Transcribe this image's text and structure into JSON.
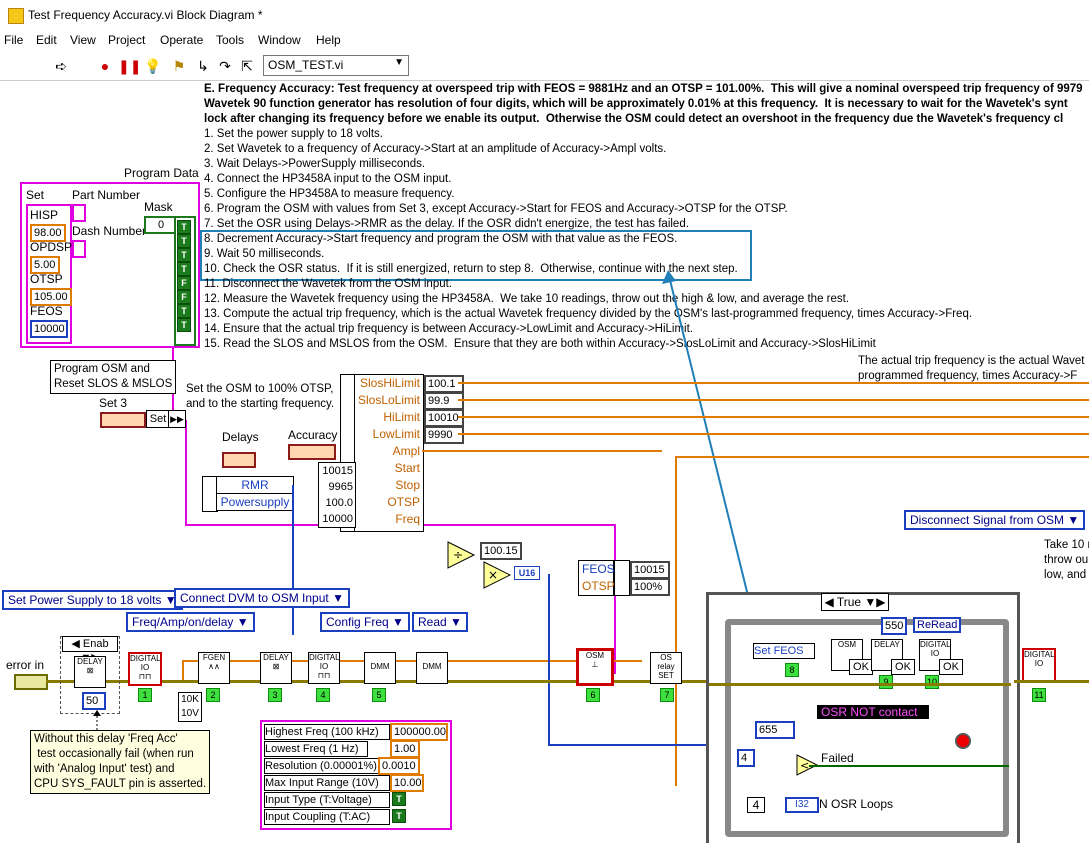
{
  "window": {
    "title": "Test Frequency Accuracy.vi Block Diagram *"
  },
  "menu": [
    "File",
    "Edit",
    "View",
    "Project",
    "Operate",
    "Tools",
    "Window",
    "Help"
  ],
  "toolbar": {
    "context_dropdown": "OSM_TEST.vi"
  },
  "comment": {
    "heading": "E. Frequency Accuracy: Test frequency at overspeed trip with FEOS = 9881Hz and an OTSP = 101.00%.  This will give a nominal overspeed trip frequency of 9979",
    "line2": "Wavetek 90 function generator has resolution of four digits, which will be approximately 0.01% at this frequency.  It is necessary to wait for the Wavetek's synt",
    "line3": "lock after changing its frequency before we enable its output.  Otherwise the OSM could detect an overshoot in the frequency due the Wavetek's frequency cl",
    "steps": [
      "1. Set the power supply to 18 volts.",
      "2. Set Wavetek to a frequency of Accuracy->Start at an amplitude of Accuracy->Ampl volts.",
      "3. Wait Delays->PowerSupply milliseconds.",
      "4. Connect the HP3458A input to the OSM input.",
      "5. Configure the HP3458A to measure frequency.",
      "6. Program the OSM with values from Set 3, except Accuracy->Start for FEOS and Accuracy->OTSP for the OTSP.",
      "7. Set the OSR using Delays->RMR as the delay. If the OSR didn't energize, the test has failed.",
      "8. Decrement Accuracy->Start frequency and program the OSM with that value as the FEOS.",
      "9. Wait 50 milliseconds.",
      "10. Check the OSR status.  If it is still energized, return to step 8.  Otherwise, continue with the next step.",
      "11. Disconnect the Wavetek from the OSM input.",
      "12. Measure the Wavetek frequency using the HP3458A.  We take 10 readings, throw out the high & low, and average the rest.",
      "13. Compute the actual trip frequency, which is the actual Wavetek frequency divided by the OSM's last-programmed frequency, times Accuracy->Freq.",
      "14. Ensure that the actual trip frequency is between Accuracy->LowLimit and Accuracy->HiLimit.",
      "15. Read the SLOS and MSLOS from the OSM.  Ensure that they are both within Accuracy->SlosLoLimit and Accuracy->SlosHiLimit"
    ],
    "right_note": "The actual trip frequency is the actual Wavet\nprogrammed frequency, times Accuracy->F"
  },
  "program_data": {
    "label": "Program Data",
    "set": "Set",
    "hisp": "HISP",
    "hisp_val": "98.00",
    "opdsp": "OPDSP",
    "opdsp_val": "5.00",
    "otsp": "OTSP",
    "otsp_val": "105.00",
    "feos": "FEOS",
    "feos_val": "10000",
    "part_number": "Part Number",
    "dash_number": "Dash Number",
    "mask": "Mask",
    "mask_val": "0",
    "bools": [
      "T",
      "T",
      "T",
      "T",
      "F",
      "F",
      "T",
      "T",
      "T"
    ]
  },
  "labels": {
    "program_osm": "Program OSM and\nReset SLOS & MSLOS",
    "set3": "Set 3",
    "set_node": "Set",
    "set_osm_note": "Set the OSM to 100% OTSP,\nand to the starting frequency.",
    "delays": "Delays",
    "accuracy": "Accuracy",
    "rmr": "RMR",
    "powersupply": "Powersupply",
    "error_in": "error in",
    "delay_comment": "Without this delay 'Freq Acc'\n test occasionally fail (when run\nwith 'Analog Input' test) and\nCPU SYS_FAULT pin is asserted.",
    "failed": "Failed",
    "n_osr_loops": "N OSR Loops",
    "take10": "Take 10 r\nthrow ou\nlow, and"
  },
  "accuracy_cluster": {
    "fields": [
      "SlosHiLimit",
      "SlosLoLimit",
      "HiLimit",
      "LowLimit",
      "Ampl",
      "Start",
      "Stop",
      "OTSP",
      "Freq"
    ],
    "constants": [
      "100.1",
      "99.9",
      "10010",
      "9990"
    ],
    "left_vals": [
      "10015",
      "9965",
      "100.0",
      "10000"
    ]
  },
  "rings": {
    "set_power": "Set Power Supply to 18 volts",
    "connect_dvm": "Connect DVM to OSM Input",
    "freq_amp": "Freq/Amp/on/delay",
    "config_freq": "Config Freq",
    "read": "Read",
    "disconnect": "Disconnect Signal from OSM",
    "enab": "Enab",
    "case_true": "True",
    "reread": "ReRead"
  },
  "values": {
    "delay50": "50",
    "divide_out": "100.15",
    "u16": "U16",
    "feos_out": "10015",
    "otsp_out": "100%",
    "const_550": "550",
    "const_4": "4",
    "const_655": "655",
    "i32": "I32",
    "n_loops": "4",
    "fgen_10k": "10K",
    "fgen_10v": "10V"
  },
  "dvm_cluster": {
    "fields": [
      "Highest Freq (100 kHz)",
      "Lowest Freq (1 Hz)",
      "Resolution (0.00001%)",
      "Max Input Range (10V)",
      "Input Type (T:Voltage)",
      "Input Coupling (T:AC)"
    ],
    "values": [
      "100000.00",
      "1.00",
      "0.0010",
      "10.00",
      "T",
      "T"
    ]
  },
  "step_labels": [
    "1",
    "2",
    "3",
    "4",
    "5",
    "6",
    "7",
    "8",
    "9",
    "10",
    "11"
  ],
  "subvis": {
    "delay": "DELAY",
    "digital_io": "DIGITAL IO",
    "fgen": "FGEN",
    "dmm": "DMM",
    "osm": "OSM",
    "os_relay": "OS relay SET",
    "set_feos": "Set FEOS",
    "ok": "OK",
    "osr_text": "OSR NOT contact"
  }
}
